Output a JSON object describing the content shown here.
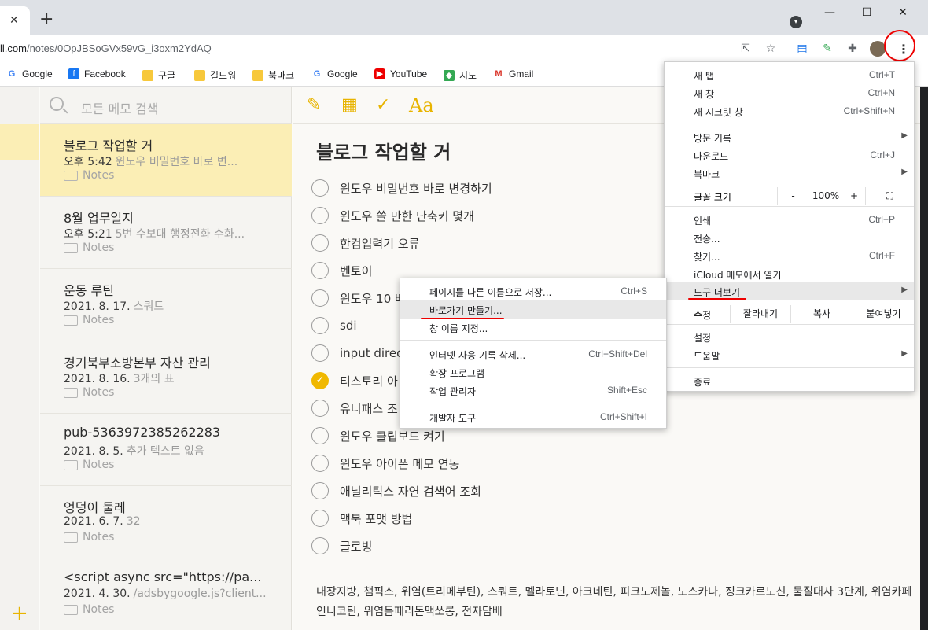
{
  "browser": {
    "url_host": "ll.com",
    "url_path": "/notes/0OpJBSoGVx59vG_i3oxm2YdAQ",
    "new_tab": "+",
    "tab_close": "✕"
  },
  "bookmarks": [
    {
      "label": "Google",
      "icon": "google-icon"
    },
    {
      "label": "Facebook",
      "icon": "facebook-icon"
    },
    {
      "label": "구글",
      "icon": "folder-icon"
    },
    {
      "label": "길드워",
      "icon": "folder-icon"
    },
    {
      "label": "북마크",
      "icon": "folder-icon"
    },
    {
      "label": "Google",
      "icon": "google-icon"
    },
    {
      "label": "YouTube",
      "icon": "youtube-icon"
    },
    {
      "label": "지도",
      "icon": "maps-icon"
    },
    {
      "label": "Gmail",
      "icon": "gmail-icon"
    }
  ],
  "notes": {
    "search_placeholder": "모든 메모 검색",
    "items": [
      {
        "title": "블로그 작업할 거",
        "time": "오후 5:42",
        "preview": "윈도우 비밀번호 바로 변...",
        "folder": "Notes"
      },
      {
        "title": "8월 업무일지",
        "time": "오후 5:21",
        "preview": "5번 수보대 행정전화 수화...",
        "folder": "Notes"
      },
      {
        "title": "운동 루틴",
        "time": "2021. 8. 17.",
        "preview": "스쿼트",
        "folder": "Notes"
      },
      {
        "title": "경기북부소방본부 자산 관리",
        "time": "2021. 8. 16.",
        "preview": "3개의 표",
        "folder": "Notes"
      },
      {
        "title": "pub-5363972385262283",
        "time": "2021. 8. 5.",
        "preview": "추가 텍스트 없음",
        "folder": "Notes"
      },
      {
        "title": "엉덩이 둘레",
        "time": "2021. 6. 7.",
        "preview": "32",
        "folder": "Notes"
      },
      {
        "title": "<script async src=\"https://pa...",
        "time": "2021. 4. 30.",
        "preview": "/adsbygoogle.js?client...",
        "folder": "Notes"
      }
    ]
  },
  "editor": {
    "title": "블로그 작업할 거",
    "checklist": [
      {
        "text": "윈도우 비밀번호 바로 변경하기",
        "done": false
      },
      {
        "text": "윈도우 쓸 만한 단축키 몇개",
        "done": false
      },
      {
        "text": "한컴입력기 오류",
        "done": false
      },
      {
        "text": "벤토이",
        "done": false
      },
      {
        "text": "윈도우 10 배",
        "done": false
      },
      {
        "text": "sdi",
        "done": false
      },
      {
        "text": "input direc",
        "done": false
      },
      {
        "text": "티스토리 아",
        "done": true
      },
      {
        "text": "유니패스 조",
        "done": false
      },
      {
        "text": "윈도우 클립보드 켜기",
        "done": false
      },
      {
        "text": "윈도우 아이폰 메모 연동",
        "done": false
      },
      {
        "text": "애널리틱스 자연 검색어 조회",
        "done": false
      },
      {
        "text": "맥북 포맷 방법",
        "done": false
      },
      {
        "text": "글로빙",
        "done": false
      }
    ],
    "paragraph": "내장지방, 챔픽스, 위염(트리메부틴), 스쿼트, 멜라토닌, 아크네틴, 피크노제놀, 노스카나, 징크카르노신, 물질대사 3단계, 위염카페인니코틴, 위염돔페리돈맥쏘롱, 전자담배"
  },
  "chrome_menu": {
    "new_tab": {
      "label": "새 탭",
      "shortcut": "Ctrl+T"
    },
    "new_window": {
      "label": "새 창",
      "shortcut": "Ctrl+N"
    },
    "incognito": {
      "label": "새 시크릿 창",
      "shortcut": "Ctrl+Shift+N"
    },
    "history": {
      "label": "방문 기록"
    },
    "downloads": {
      "label": "다운로드",
      "shortcut": "Ctrl+J"
    },
    "bookmarks": {
      "label": "북마크"
    },
    "zoom": {
      "label": "글꼴 크기",
      "minus": "-",
      "value": "100%",
      "plus": "+"
    },
    "print": {
      "label": "인쇄",
      "shortcut": "Ctrl+P"
    },
    "cast": {
      "label": "전송..."
    },
    "find": {
      "label": "찾기...",
      "shortcut": "Ctrl+F"
    },
    "open_in": {
      "label": "iCloud 메모에서 열기"
    },
    "more_tools": {
      "label": "도구 더보기"
    },
    "edit": {
      "label": "수정",
      "cut": "잘라내기",
      "copy": "복사",
      "paste": "붙여넣기"
    },
    "settings": {
      "label": "설정"
    },
    "help": {
      "label": "도움말"
    },
    "exit": {
      "label": "종료"
    }
  },
  "submenu": {
    "save_as": {
      "label": "페이지를 다른 이름으로 저장...",
      "shortcut": "Ctrl+S"
    },
    "create_shortcut": {
      "label": "바로가기 만들기..."
    },
    "name_window": {
      "label": "창 이름 지정..."
    },
    "clear_data": {
      "label": "인터넷 사용 기록 삭제...",
      "shortcut": "Ctrl+Shift+Del"
    },
    "extensions": {
      "label": "확장 프로그램"
    },
    "task_manager": {
      "label": "작업 관리자",
      "shortcut": "Shift+Esc"
    },
    "dev_tools": {
      "label": "개발자 도구",
      "shortcut": "Ctrl+Shift+I"
    }
  },
  "colors": {
    "accent": "#e8b400",
    "selected": "#fbeeb5",
    "annotation": "#ee0000"
  }
}
